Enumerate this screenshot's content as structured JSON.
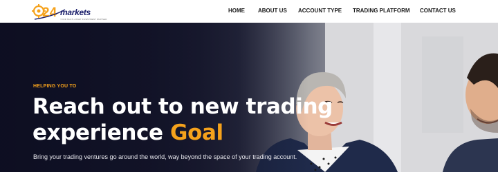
{
  "brand": {
    "logo_text": "markets",
    "logo_tagline": "YOUR MULTI-ASSET INVESTMENT PARTNER",
    "logo_mark": "24"
  },
  "nav": {
    "items": [
      {
        "label": "HOME"
      },
      {
        "label": "ABOUT US"
      },
      {
        "label": "ACCOUNT TYPE"
      },
      {
        "label": "TRADING PLATFORM"
      },
      {
        "label": "CONTACT US"
      }
    ]
  },
  "hero": {
    "eyebrow": "HELPING YOU TO",
    "title_line1": "Reach out to new trading",
    "title_line2_prefix": "experience ",
    "title_accent": "Goal",
    "subtitle": "Bring your trading ventures go around the world, way beyond the space of your trading account."
  },
  "colors": {
    "accent": "#f5a21c",
    "brand_navy": "#1b1f6b",
    "hero_dark": "#15162c",
    "nav_text": "#1a1a1a"
  }
}
